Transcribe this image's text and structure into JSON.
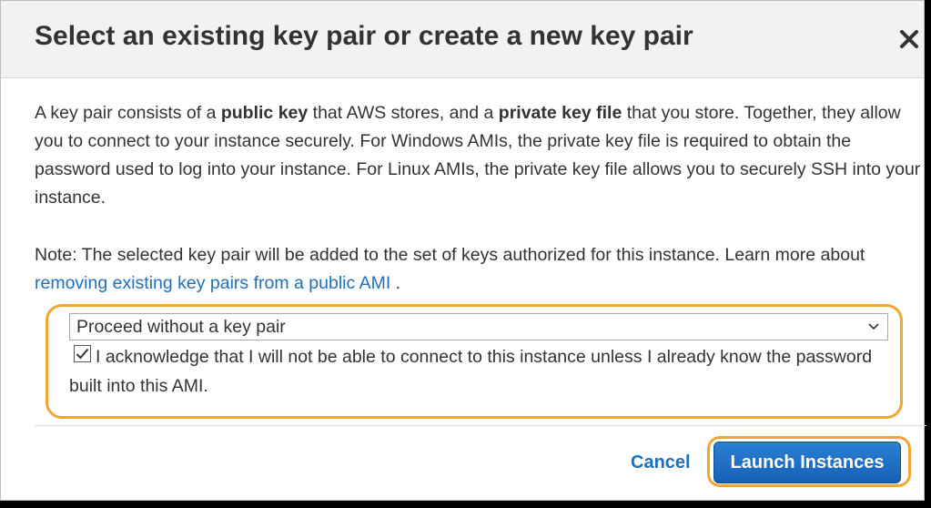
{
  "dialog": {
    "title": "Select an existing key pair or create a new key pair",
    "close_icon": "close-icon"
  },
  "intro": {
    "t1": "A key pair consists of a ",
    "b1": "public key",
    "t2": " that AWS stores, and a ",
    "b2": "private key file",
    "t3": " that you store. Together, they allow you to connect to your instance securely. For Windows AMIs, the private key file is required to obtain the password used to log into your instance. For Linux AMIs, the private key file allows you to securely SSH into your instance."
  },
  "note": {
    "text": "Note: The selected key pair will be added to the set of keys authorized for this instance. Learn more about ",
    "link": "removing existing key pairs from a public AMI",
    "end": " ."
  },
  "key_pair": {
    "selected": "Proceed without a key pair",
    "chevron_icon": "chevron-down-icon"
  },
  "acknowledge": {
    "checked": true,
    "text": "I acknowledge that I will not be able to connect to this instance unless I already know the password built into this AMI."
  },
  "footer": {
    "cancel_label": "Cancel",
    "launch_label": "Launch Instances"
  },
  "colors": {
    "accent": "#1f6fb9",
    "highlight": "#f3a533",
    "header_bg": "#f2f2f2",
    "text": "#333333"
  }
}
